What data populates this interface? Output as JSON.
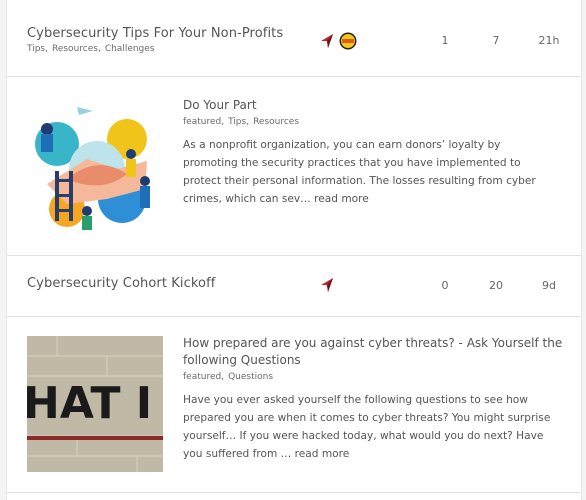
{
  "rows": [
    {
      "title": "Cybersecurity Tips For Your Non-Profits",
      "tags": [
        "Tips,",
        "Resources,",
        "Challenges"
      ],
      "avatars": [
        "red-bird-avatar",
        "yellow-badge-avatar"
      ],
      "replies": "1",
      "views": "7",
      "activity": "21h"
    },
    {
      "title": "Cybersecurity Cohort Kickoff",
      "avatars": [
        "red-bird-avatar"
      ],
      "replies": "0",
      "views": "20",
      "activity": "9d"
    }
  ],
  "featured": [
    {
      "title": "Do Your Part",
      "tags": [
        "featured,",
        "Tips,",
        "Resources"
      ],
      "excerpt": "As a nonprofit organization, you can earn donors’ loyalty by promoting the security practices that you have implemented to protect their personal information. The losses resulting from cyber crimes, which can sev…",
      "read_more": "read more"
    },
    {
      "title": "How prepared are you against cyber threats? - Ask Yourself the following Questions",
      "tags": [
        "featured,",
        "Questions"
      ],
      "excerpt": "Have you ever asked yourself the following questions to see how prepared you are when it comes to cyber threats? You might surprise yourself… If you were hacked today, what would you do next? Have you suffered from …",
      "read_more": "read more"
    }
  ],
  "thumb2_text": "HAT I"
}
